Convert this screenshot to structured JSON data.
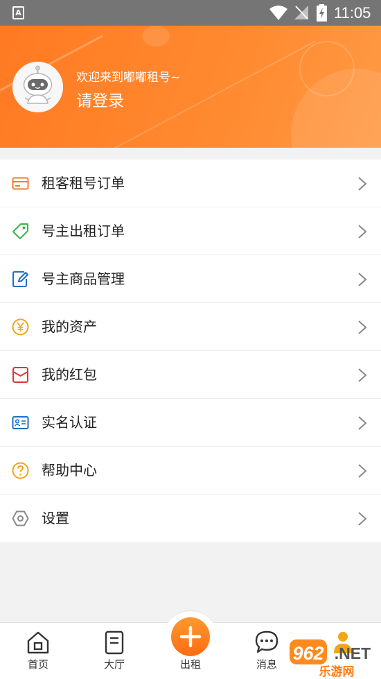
{
  "status_bar": {
    "notification_icon": "A",
    "time": "11:05"
  },
  "header": {
    "welcome": "欢迎来到嘟嘟租号~",
    "login": "请登录"
  },
  "menu": [
    {
      "label": "租客租号订单",
      "icon": "card-icon",
      "color": "#f07c2b"
    },
    {
      "label": "号主出租订单",
      "icon": "tag-icon",
      "color": "#3ab44a"
    },
    {
      "label": "号主商品管理",
      "icon": "edit-note-icon",
      "color": "#1e6fc4"
    },
    {
      "label": "我的资产",
      "icon": "yen-coin-icon",
      "color": "#f2a516"
    },
    {
      "label": "我的红包",
      "icon": "red-envelope-icon",
      "color": "#e6322f"
    },
    {
      "label": "实名认证",
      "icon": "id-card-icon",
      "color": "#1e6fc4"
    },
    {
      "label": "帮助中心",
      "icon": "question-icon",
      "color": "#f2a516"
    },
    {
      "label": "设置",
      "icon": "hexagon-gear-icon",
      "color": "#8a8a8a"
    }
  ],
  "bottom_nav": {
    "home": "首页",
    "hall": "大厅",
    "rent": "出租",
    "messages": "消息"
  },
  "watermark": {
    "number": "962",
    "suffix": ".NET",
    "site": "乐游网"
  },
  "colors": {
    "accent": "#ff7a22",
    "background": "#f2f2f2"
  }
}
